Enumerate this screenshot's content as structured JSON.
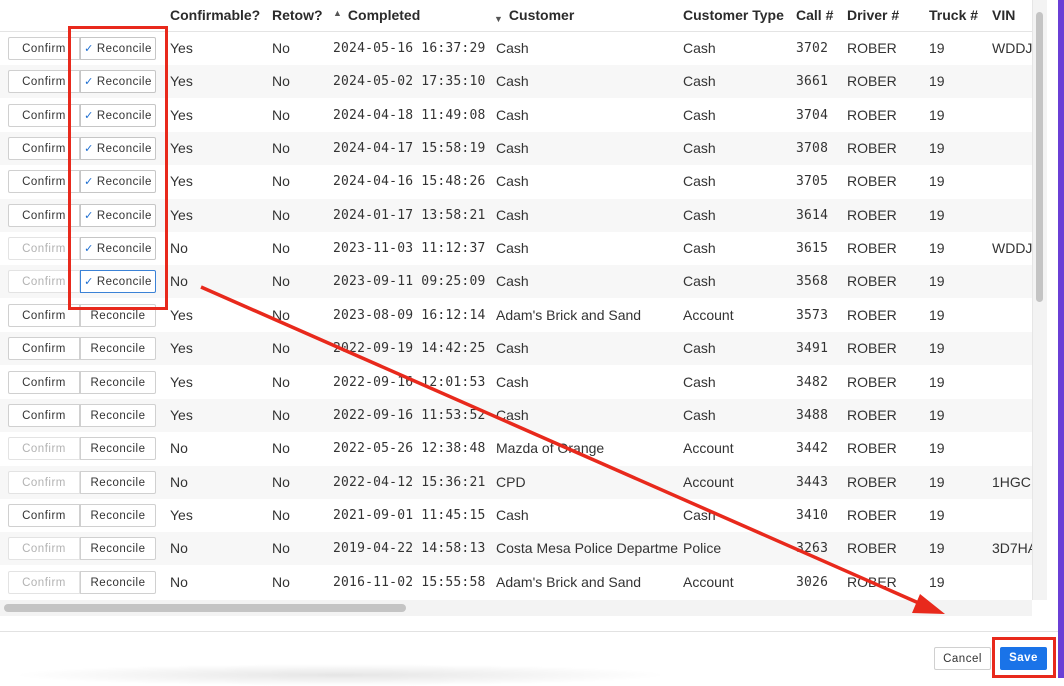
{
  "columns": {
    "confirmable": "Confirmable?",
    "retow": "Retow?",
    "completed": "Completed",
    "customer": "Customer",
    "customer_type": "Customer Type",
    "call": "Call #",
    "driver": "Driver #",
    "truck": "Truck #",
    "vin": "VIN"
  },
  "buttons": {
    "confirm": "Confirm",
    "reconcile": "Reconcile",
    "cancel": "Cancel",
    "save": "Save"
  },
  "icons": {
    "sort_asc": "▲",
    "sort_desc": "▼",
    "check": "✓"
  },
  "accent_color": "#1a73e8",
  "annotation_color": "#e8291c",
  "rows": [
    {
      "confirmable": "Yes",
      "retow": "No",
      "completed": "2024-05-16 16:37:29",
      "customer": "Cash",
      "customer_type": "Cash",
      "call": "3702",
      "driver": "ROBER",
      "truck": "19",
      "vin": "WDDJ",
      "confirm_enabled": true,
      "reconciled": true
    },
    {
      "confirmable": "Yes",
      "retow": "No",
      "completed": "2024-05-02 17:35:10",
      "customer": "Cash",
      "customer_type": "Cash",
      "call": "3661",
      "driver": "ROBER",
      "truck": "19",
      "vin": "",
      "confirm_enabled": true,
      "reconciled": true
    },
    {
      "confirmable": "Yes",
      "retow": "No",
      "completed": "2024-04-18 11:49:08",
      "customer": "Cash",
      "customer_type": "Cash",
      "call": "3704",
      "driver": "ROBER",
      "truck": "19",
      "vin": "",
      "confirm_enabled": true,
      "reconciled": true
    },
    {
      "confirmable": "Yes",
      "retow": "No",
      "completed": "2024-04-17 15:58:19",
      "customer": "Cash",
      "customer_type": "Cash",
      "call": "3708",
      "driver": "ROBER",
      "truck": "19",
      "vin": "",
      "confirm_enabled": true,
      "reconciled": true
    },
    {
      "confirmable": "Yes",
      "retow": "No",
      "completed": "2024-04-16 15:48:26",
      "customer": "Cash",
      "customer_type": "Cash",
      "call": "3705",
      "driver": "ROBER",
      "truck": "19",
      "vin": "",
      "confirm_enabled": true,
      "reconciled": true
    },
    {
      "confirmable": "Yes",
      "retow": "No",
      "completed": "2024-01-17 13:58:21",
      "customer": "Cash",
      "customer_type": "Cash",
      "call": "3614",
      "driver": "ROBER",
      "truck": "19",
      "vin": "",
      "confirm_enabled": true,
      "reconciled": true
    },
    {
      "confirmable": "No",
      "retow": "No",
      "completed": "2023-11-03 11:12:37",
      "customer": "Cash",
      "customer_type": "Cash",
      "call": "3615",
      "driver": "ROBER",
      "truck": "19",
      "vin": "WDDJ",
      "confirm_enabled": false,
      "reconciled": true
    },
    {
      "confirmable": "No",
      "retow": "No",
      "completed": "2023-09-11 09:25:09",
      "customer": "Cash",
      "customer_type": "Cash",
      "call": "3568",
      "driver": "ROBER",
      "truck": "19",
      "vin": "",
      "confirm_enabled": false,
      "reconciled": true
    },
    {
      "confirmable": "Yes",
      "retow": "No",
      "completed": "2023-08-09 16:12:14",
      "customer": "Adam's Brick and Sand",
      "customer_type": "Account",
      "call": "3573",
      "driver": "ROBER",
      "truck": "19",
      "vin": "",
      "confirm_enabled": true,
      "reconciled": false
    },
    {
      "confirmable": "Yes",
      "retow": "No",
      "completed": "2022-09-19 14:42:25",
      "customer": "Cash",
      "customer_type": "Cash",
      "call": "3491",
      "driver": "ROBER",
      "truck": "19",
      "vin": "",
      "confirm_enabled": true,
      "reconciled": false
    },
    {
      "confirmable": "Yes",
      "retow": "No",
      "completed": "2022-09-16 12:01:53",
      "customer": "Cash",
      "customer_type": "Cash",
      "call": "3482",
      "driver": "ROBER",
      "truck": "19",
      "vin": "",
      "confirm_enabled": true,
      "reconciled": false
    },
    {
      "confirmable": "Yes",
      "retow": "No",
      "completed": "2022-09-16 11:53:52",
      "customer": "Cash",
      "customer_type": "Cash",
      "call": "3488",
      "driver": "ROBER",
      "truck": "19",
      "vin": "",
      "confirm_enabled": true,
      "reconciled": false
    },
    {
      "confirmable": "No",
      "retow": "No",
      "completed": "2022-05-26 12:38:48",
      "customer": "Mazda of Orange",
      "customer_type": "Account",
      "call": "3442",
      "driver": "ROBER",
      "truck": "19",
      "vin": "",
      "confirm_enabled": false,
      "reconciled": false
    },
    {
      "confirmable": "No",
      "retow": "No",
      "completed": "2022-04-12 15:36:21",
      "customer": "CPD",
      "customer_type": "Account",
      "call": "3443",
      "driver": "ROBER",
      "truck": "19",
      "vin": "1HGC",
      "confirm_enabled": false,
      "reconciled": false
    },
    {
      "confirmable": "Yes",
      "retow": "No",
      "completed": "2021-09-01 11:45:15",
      "customer": "Cash",
      "customer_type": "Cash",
      "call": "3410",
      "driver": "ROBER",
      "truck": "19",
      "vin": "",
      "confirm_enabled": true,
      "reconciled": false
    },
    {
      "confirmable": "No",
      "retow": "No",
      "completed": "2019-04-22 14:58:13",
      "customer": "Costa Mesa Police Departme",
      "customer_type": "Police",
      "call": "3263",
      "driver": "ROBER",
      "truck": "19",
      "vin": "3D7HA",
      "confirm_enabled": false,
      "reconciled": false
    },
    {
      "confirmable": "No",
      "retow": "No",
      "completed": "2016-11-02 15:55:58",
      "customer": "Adam's Brick and Sand",
      "customer_type": "Account",
      "call": "3026",
      "driver": "ROBER",
      "truck": "19",
      "vin": "",
      "confirm_enabled": false,
      "reconciled": false
    }
  ]
}
